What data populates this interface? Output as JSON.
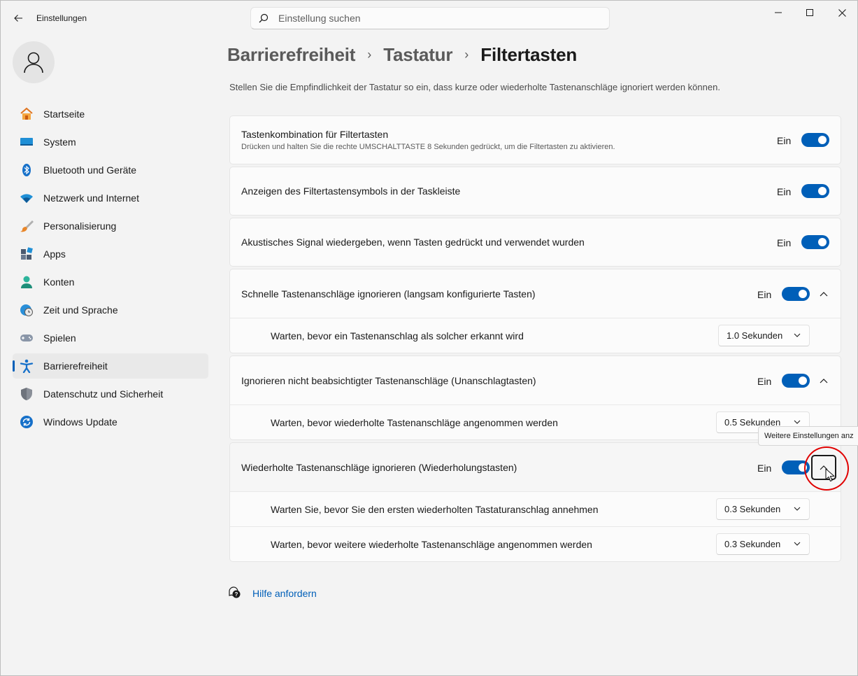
{
  "app": {
    "title": "Einstellungen"
  },
  "search": {
    "placeholder": "Einstellung suchen"
  },
  "nav": {
    "items": [
      {
        "label": "Startseite",
        "icon": "home-icon"
      },
      {
        "label": "System",
        "icon": "monitor-icon"
      },
      {
        "label": "Bluetooth und Geräte",
        "icon": "bluetooth-icon"
      },
      {
        "label": "Netzwerk und Internet",
        "icon": "wifi-icon"
      },
      {
        "label": "Personalisierung",
        "icon": "brush-icon"
      },
      {
        "label": "Apps",
        "icon": "apps-icon"
      },
      {
        "label": "Konten",
        "icon": "account-icon"
      },
      {
        "label": "Zeit und Sprache",
        "icon": "globe-clock-icon"
      },
      {
        "label": "Spielen",
        "icon": "gamepad-icon"
      },
      {
        "label": "Barrierefreiheit",
        "icon": "accessibility-icon",
        "active": true
      },
      {
        "label": "Datenschutz und Sicherheit",
        "icon": "shield-icon"
      },
      {
        "label": "Windows Update",
        "icon": "update-icon"
      }
    ]
  },
  "breadcrumb": {
    "level1": "Barrierefreiheit",
    "level2": "Tastatur",
    "current": "Filtertasten",
    "separator": "›"
  },
  "description": "Stellen Sie die Empfindlichkeit der Tastatur so ein, dass kurze oder wiederholte Tastenanschläge ignoriert werden können.",
  "settings": {
    "shortcut": {
      "title": "Tastenkombination für Filtertasten",
      "subtitle": "Drücken und halten Sie die rechte UMSCHALTTASTE 8 Sekunden gedrückt, um die Filtertasten zu aktivieren.",
      "state": "Ein"
    },
    "taskbar_icon": {
      "title": "Anzeigen des Filtertastensymbols in der Taskleiste",
      "state": "Ein"
    },
    "sound": {
      "title": "Akustisches Signal wiedergeben, wenn Tasten gedrückt und verwendet wurden",
      "state": "Ein"
    },
    "slow_keys": {
      "title": "Schnelle Tastenanschläge ignorieren (langsam konfigurierte Tasten)",
      "state": "Ein",
      "sub": [
        {
          "label": "Warten, bevor ein Tastenanschlag als solcher erkannt wird",
          "value": "1.0 Sekunden"
        }
      ]
    },
    "bounce_keys": {
      "title": "Ignorieren nicht beabsichtigter Tastenanschläge (Unanschlagtasten)",
      "state": "Ein",
      "sub": [
        {
          "label": "Warten, bevor wiederholte Tastenanschläge angenommen werden",
          "value": "0.5 Sekunden"
        }
      ]
    },
    "repeat_keys": {
      "title": "Wiederholte Tastenanschläge ignorieren (Wiederholungstasten)",
      "state": "Ein",
      "sub": [
        {
          "label": "Warten Sie, bevor Sie den ersten wiederholten Tastaturanschlag annehmen",
          "value": "0.3 Sekunden"
        },
        {
          "label": "Warten, bevor weitere wiederholte Tastenanschläge angenommen werden",
          "value": "0.3 Sekunden"
        }
      ]
    }
  },
  "tooltip": "Weitere Einstellungen anz",
  "help": {
    "label": "Hilfe anfordern"
  },
  "colors": {
    "accent": "#005fb8",
    "highlight": "#e00000"
  }
}
